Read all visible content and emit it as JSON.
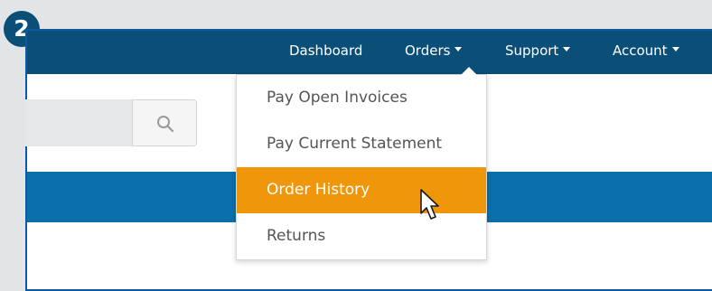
{
  "step_badge": "2",
  "navbar": {
    "dashboard": "Dashboard",
    "orders": "Orders",
    "support": "Support",
    "account": "Account"
  },
  "search": {
    "placeholder": "",
    "icon": "search-icon"
  },
  "orders_menu": {
    "items": [
      {
        "label": "Pay Open Invoices",
        "active": false
      },
      {
        "label": "Pay Current Statement",
        "active": false
      },
      {
        "label": "Order History",
        "active": true
      },
      {
        "label": "Returns",
        "active": false
      }
    ]
  },
  "colors": {
    "navbar": "#0b4f78",
    "band": "#0b6fab",
    "highlight": "#f0960a",
    "frame_border": "#0c5aa2",
    "background": "#e3e4e6"
  }
}
